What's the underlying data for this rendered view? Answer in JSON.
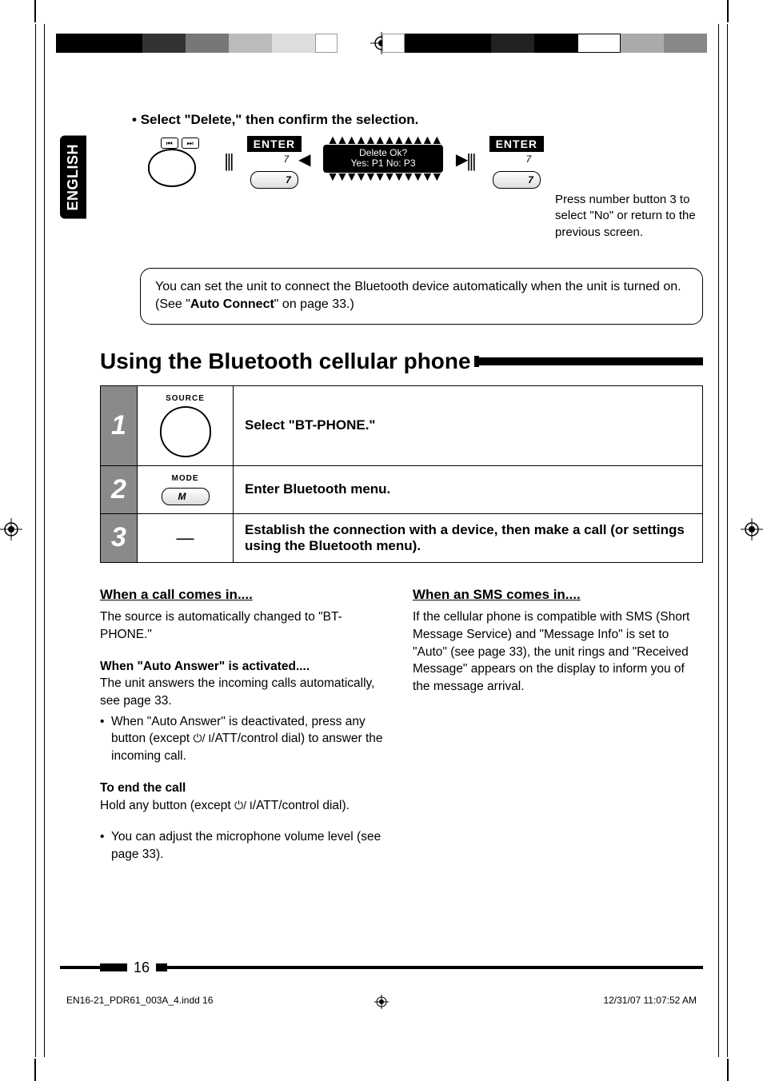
{
  "language_tab": "ENGLISH",
  "top_instruction": "Select \"Delete,\" then confirm the selection.",
  "diagram": {
    "enter_label": "ENTER",
    "button7": "7",
    "lcd_line1": "Delete Ok?",
    "lcd_line2": "Yes: P1   No: P3",
    "note_right": "Press number button 3 to select \"No\" or return to the previous screen."
  },
  "tip_box": {
    "text_before": "You can set the unit to connect the Bluetooth device automatically when the unit is turned on. (See \"",
    "bold": "Auto Connect",
    "text_after": "\" on page 33.)"
  },
  "section_title": "Using the Bluetooth cellular phone",
  "steps": [
    {
      "num": "1",
      "ctrl_label": "SOURCE",
      "ctrl_type": "dial",
      "text": "Select \"BT-PHONE.\""
    },
    {
      "num": "2",
      "ctrl_label": "MODE",
      "ctrl_type": "pill",
      "pill_text": "M",
      "text": "Enter Bluetooth menu."
    },
    {
      "num": "3",
      "ctrl_label": "",
      "ctrl_type": "dash",
      "text": "Establish the connection with a device, then make a call (or settings using the Bluetooth menu)."
    }
  ],
  "left_col": {
    "h1": "When a call comes in....",
    "p1": "The source is automatically changed to \"BT-PHONE.\"",
    "h2": "When \"Auto Answer\" is activated....",
    "p2": "The unit answers the incoming calls automatically, see page 33.",
    "li1a": "When \"Auto Answer\" is deactivated, press any button (except ",
    "li1b": "/ATT/control dial) to answer the incoming call.",
    "h3": "To end the call",
    "p3a": "Hold any button (except ",
    "p3b": "/ATT/control dial).",
    "li2": "You can adjust the microphone volume level (see page 33)."
  },
  "right_col": {
    "h1": "When an SMS comes in....",
    "p1": "If the cellular phone is compatible with SMS (Short Message Service) and \"Message Info\" is set to \"Auto\" (see page 33), the unit rings and \"Received Message\" appears on the display to inform you of the message arrival."
  },
  "page_number": "16",
  "footer": {
    "file": "EN16-21_PDR61_003A_4.indd   16",
    "timestamp": "12/31/07   11:07:52 AM"
  }
}
